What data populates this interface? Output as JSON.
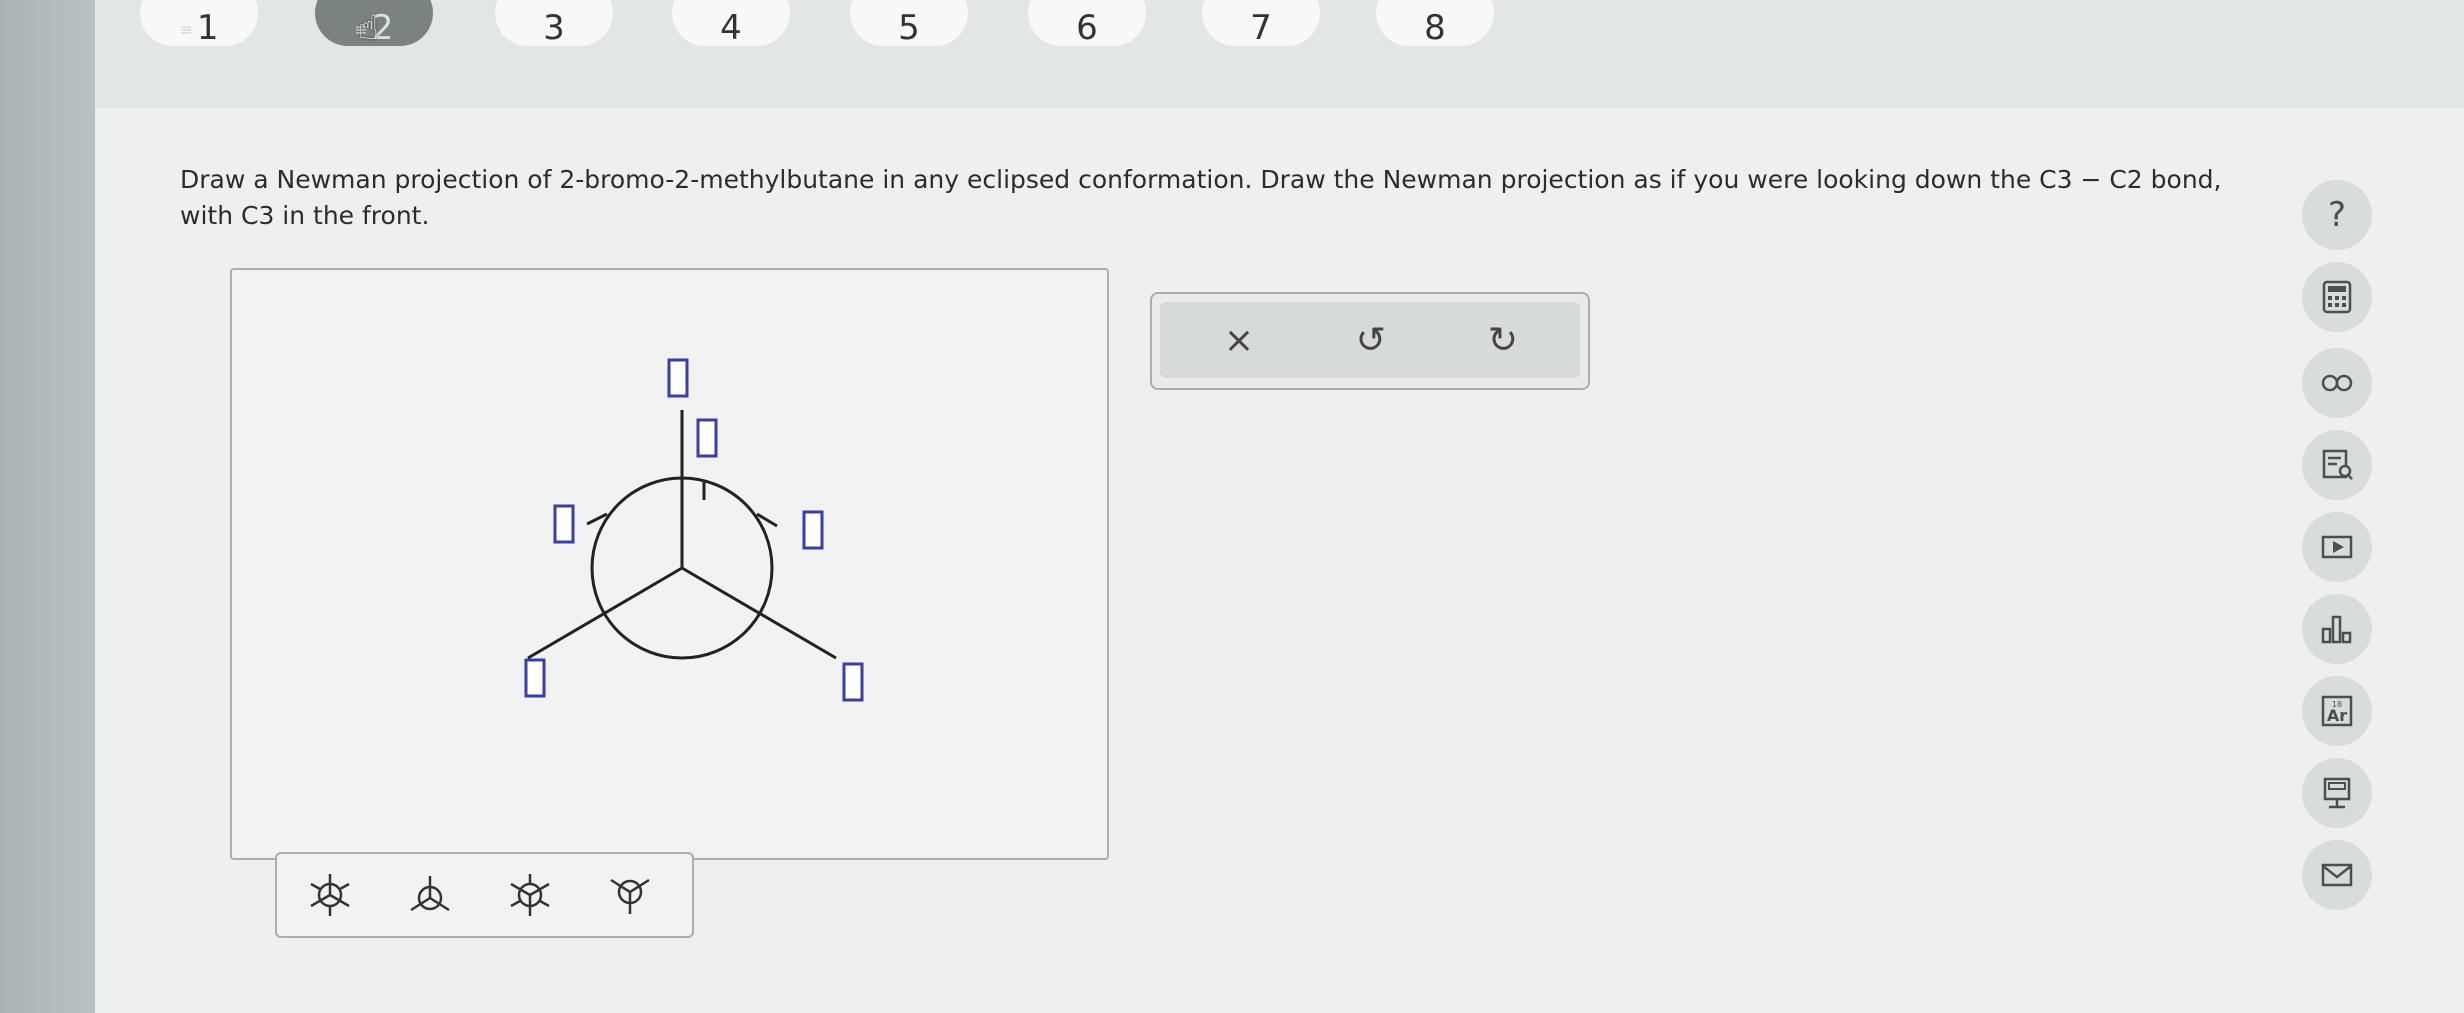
{
  "question_nav": {
    "items": [
      {
        "label": "1",
        "state": "default"
      },
      {
        "label": "2",
        "state": "active"
      },
      {
        "label": "3",
        "state": "default"
      },
      {
        "label": "4",
        "state": "default"
      },
      {
        "label": "5",
        "state": "default"
      },
      {
        "label": "6",
        "state": "default"
      },
      {
        "label": "7",
        "state": "default"
      },
      {
        "label": "8",
        "state": "default"
      }
    ]
  },
  "prompt": {
    "text": "Draw a Newman projection of 2-bromo-2-methylbutane in any eclipsed conformation. Draw the Newman projection as if you were looking down the C3 − C2 bond, with C3 in the front."
  },
  "drawing": {
    "substituent_placeholder": "▯"
  },
  "edit_toolbar": {
    "clear_label": "×",
    "undo_label": "↺",
    "redo_label": "↻"
  },
  "template_palette": {
    "tools": [
      "staggered-newman-template-icon",
      "eclipsed-newman-template-icon",
      "staggered-newman-template-alt-icon",
      "eclipsed-newman-template-alt-icon"
    ]
  },
  "sidebar": {
    "help_label": "?",
    "tools": [
      "calculator-icon",
      "infinity-icon",
      "lookup-icon",
      "video-icon",
      "chart-icon",
      "periodic-table-icon",
      "tools-icon",
      "mail-icon"
    ]
  },
  "colors": {
    "placeholder_box": "#3a3fa8",
    "active_pill": "#7b8282"
  }
}
